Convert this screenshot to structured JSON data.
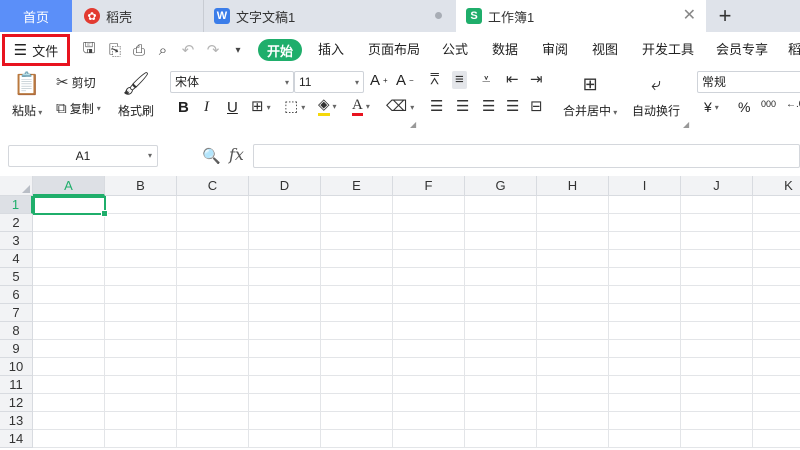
{
  "tabs": {
    "home": "首页",
    "daoke": "稻壳",
    "doc": "文字文稿1",
    "book": "工作簿1"
  },
  "menu": {
    "file": "文件",
    "items": [
      "开始",
      "插入",
      "页面布局",
      "公式",
      "数据",
      "审阅",
      "视图",
      "开发工具",
      "会员专享",
      "稻"
    ]
  },
  "ribbon": {
    "paste": "粘贴",
    "cut": "剪切",
    "copy": "复制",
    "format_painter": "格式刷",
    "font_name": "宋体",
    "font_size": "11",
    "merge_center": "合并居中",
    "wrap_text": "自动换行",
    "number_format": "常规",
    "currency": "¥",
    "percent": "%",
    "thousands": "000"
  },
  "formula_bar": {
    "name_box": "A1",
    "fx": "fx",
    "formula": ""
  },
  "sheet": {
    "columns": [
      "A",
      "B",
      "C",
      "D",
      "E",
      "F",
      "G",
      "H",
      "I",
      "J",
      "K"
    ],
    "rows": [
      "1",
      "2",
      "3",
      "4",
      "5",
      "6",
      "7",
      "8",
      "9",
      "10",
      "11",
      "12",
      "13",
      "14"
    ],
    "active_cell": "A1"
  },
  "colors": {
    "accent": "#1fae6b",
    "home_tab": "#5b8ff9",
    "highlight_box": "#e8131f"
  }
}
